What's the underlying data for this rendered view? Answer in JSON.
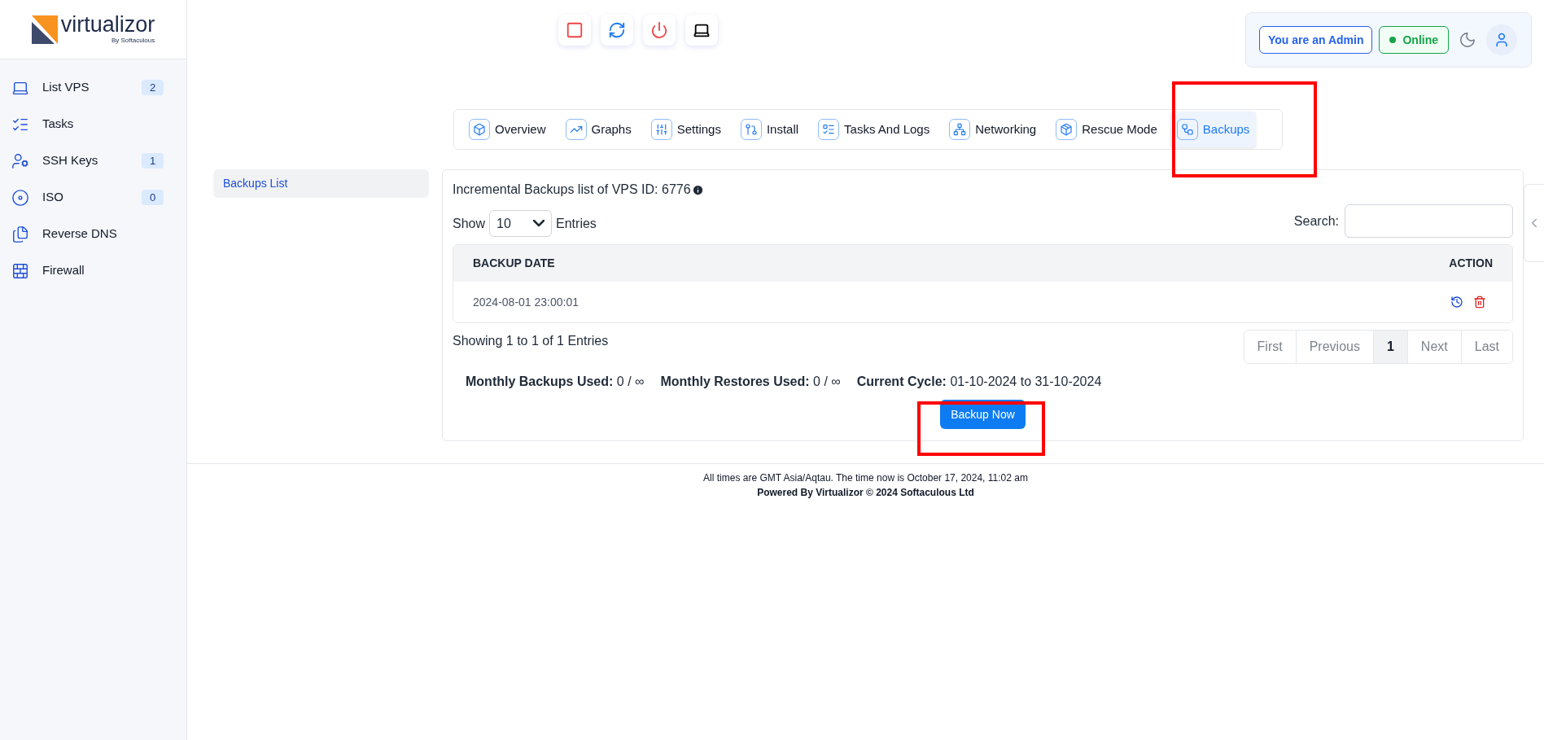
{
  "logo": {
    "name": "virtualizor",
    "byline": "By Softaculous"
  },
  "sidebar": {
    "items": [
      {
        "label": "List VPS",
        "badge": "2"
      },
      {
        "label": "Tasks"
      },
      {
        "label": "SSH Keys",
        "badge": "1"
      },
      {
        "label": "ISO",
        "badge": "0"
      },
      {
        "label": "Reverse DNS"
      },
      {
        "label": "Firewall"
      }
    ]
  },
  "header": {
    "role_badge": "You are an Admin",
    "status": {
      "label": "Online",
      "color": "#16a34a"
    }
  },
  "tabs": [
    {
      "label": "Overview",
      "selected": false
    },
    {
      "label": "Graphs",
      "selected": false
    },
    {
      "label": "Settings",
      "selected": false
    },
    {
      "label": "Install",
      "selected": false
    },
    {
      "label": "Tasks And Logs",
      "selected": false
    },
    {
      "label": "Networking",
      "selected": false
    },
    {
      "label": "Rescue Mode",
      "selected": false
    },
    {
      "label": "Backups",
      "selected": true
    }
  ],
  "subnav": {
    "items": [
      {
        "label": "Backups List",
        "selected": true
      }
    ]
  },
  "card": {
    "title": "Incremental Backups list of VPS ID: 6776",
    "show_label": "Show",
    "page_size": "10",
    "entries_label": "Entries",
    "search_label": "Search:",
    "table": {
      "columns": [
        "BACKUP DATE",
        "ACTION"
      ],
      "rows": [
        {
          "date": "2024-08-01 23:00:01"
        }
      ]
    },
    "summary": "Showing 1 to 1 of 1 Entries",
    "pagination": [
      {
        "label": "First",
        "selected": false,
        "disabled": true
      },
      {
        "label": "Previous",
        "selected": false,
        "disabled": true
      },
      {
        "label": "1",
        "selected": true,
        "disabled": false
      },
      {
        "label": "Next",
        "selected": false,
        "disabled": true
      },
      {
        "label": "Last",
        "selected": false,
        "disabled": true
      }
    ],
    "stats": [
      {
        "label": "Monthly Backups Used:",
        "value": "0 / ∞"
      },
      {
        "label": "Monthly Restores Used:",
        "value": "0 / ∞"
      },
      {
        "label": "Current Cycle:",
        "value": "01-10-2024 to 31-10-2024"
      }
    ],
    "button": "Backup Now"
  },
  "footer": {
    "line": "All times are GMT Asia/Aqtau. The time now is October 17, 2024, 11:02 am",
    "powered": "Powered By Virtualizor © 2024 Softaculous Ltd"
  }
}
